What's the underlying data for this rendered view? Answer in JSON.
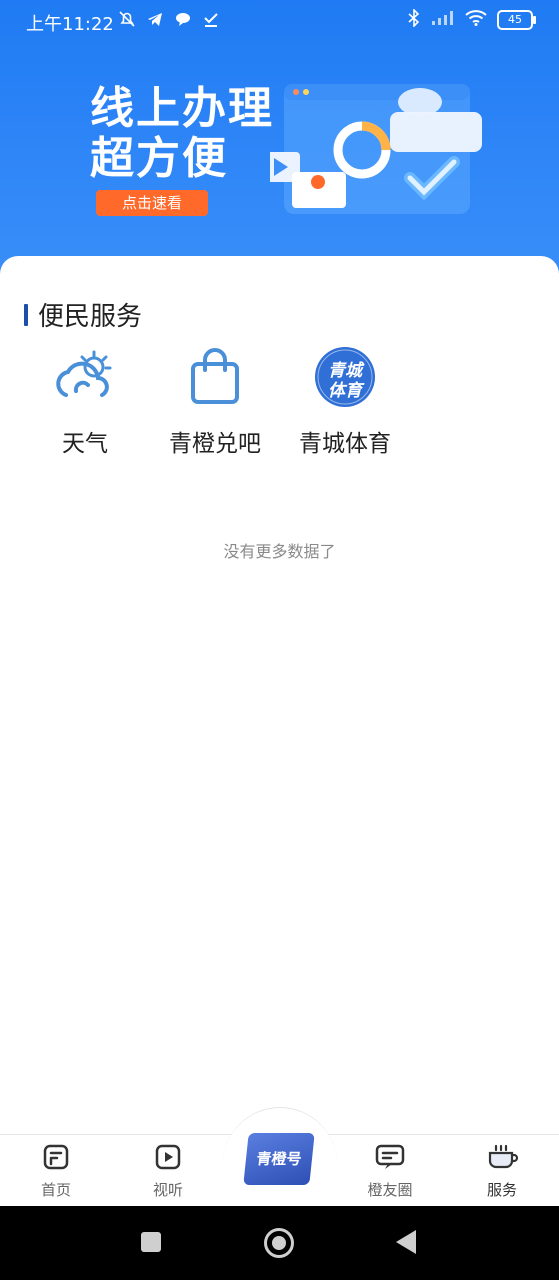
{
  "status_bar": {
    "time": "上午11:22",
    "battery": "45",
    "icons_left": [
      "mute-bell-icon",
      "telegram-icon",
      "chat-bubble-icon",
      "check-download-icon"
    ],
    "icons_right": [
      "bluetooth-icon",
      "signal-icon",
      "wifi-icon",
      "battery-icon"
    ]
  },
  "banner": {
    "line1": "线上办理",
    "line2": "超方便",
    "button": "点击速看"
  },
  "section": {
    "title": "便民服务"
  },
  "services": [
    {
      "label": "天气",
      "icon": "weather-icon"
    },
    {
      "label": "青橙兑吧",
      "icon": "shopping-bag-icon"
    },
    {
      "label": "青城体育",
      "icon": "sports-logo-icon",
      "logo_line1": "青城",
      "logo_line2": "体育"
    }
  ],
  "empty_text": "没有更多数据了",
  "tabs": [
    {
      "label": "首页",
      "icon": "home-icon"
    },
    {
      "label": "视听",
      "icon": "play-icon"
    },
    {
      "label": "青橙号",
      "icon": "qingcheng-badge"
    },
    {
      "label": "橙友圈",
      "icon": "chat-icon"
    },
    {
      "label": "服务",
      "icon": "cup-icon",
      "active": true
    }
  ],
  "colors": {
    "header_blue": "#1f7bf3",
    "accent_orange": "#ff6a2b",
    "section_bar": "#1b4fa8",
    "icon_blue": "#4a90d9"
  }
}
